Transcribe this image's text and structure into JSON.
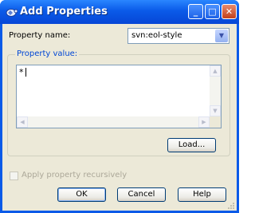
{
  "window": {
    "title": "Add Properties",
    "minimize_icon": "minimize-icon",
    "maximize_icon": "maximize-icon",
    "close_icon": "close-icon"
  },
  "property_name": {
    "label": "Property name:",
    "value": "svn:eol-style"
  },
  "property_value": {
    "legend": "Property value:",
    "text": "*"
  },
  "buttons": {
    "load": "Load...",
    "ok": "OK",
    "cancel": "Cancel",
    "help": "Help"
  },
  "apply_recursive": {
    "label": "Apply property recursively",
    "checked": false,
    "enabled": false
  },
  "colors": {
    "titlebar": "#0a5ae8",
    "dialog_bg": "#ece9d8",
    "group_legend": "#0046d5"
  }
}
